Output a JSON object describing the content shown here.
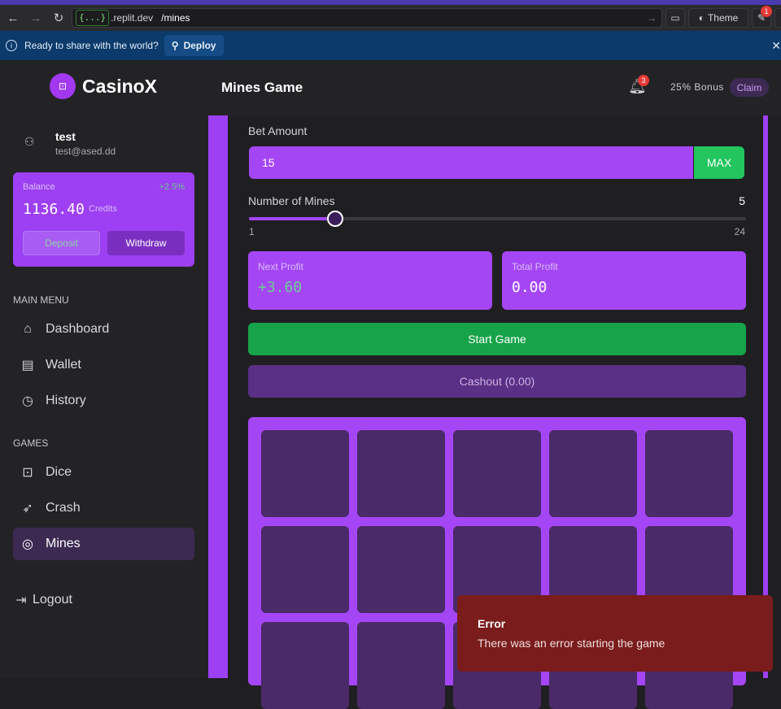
{
  "browser": {
    "domain_prefix": "{...}",
    "domain_rest": ".replit.dev",
    "path": "/mines",
    "theme_label": "Theme",
    "ext_badge": "1"
  },
  "sharebar": {
    "text": "Ready to share with the world?",
    "deploy_label": "Deploy"
  },
  "sidebar": {
    "brand": "CasinoX",
    "user_name": "test",
    "user_email": "test@ased.dd",
    "balance": {
      "label": "Balance",
      "change": "+2.5%",
      "value": "1136.40",
      "unit": "Credits",
      "deposit_label": "Deposit",
      "withdraw_label": "Withdraw"
    },
    "main_menu_label": "MAIN MENU",
    "main_menu": [
      {
        "label": "Dashboard",
        "icon": "home-icon"
      },
      {
        "label": "Wallet",
        "icon": "wallet-icon"
      },
      {
        "label": "History",
        "icon": "clock-icon"
      }
    ],
    "games_label": "GAMES",
    "games": [
      {
        "label": "Dice",
        "icon": "dice-icon"
      },
      {
        "label": "Crash",
        "icon": "rocket-icon"
      },
      {
        "label": "Mines",
        "icon": "target-icon"
      }
    ],
    "logout_label": "Logout"
  },
  "header": {
    "title": "Mines Game",
    "notifications": "3",
    "bonus_text": "25% Bonus",
    "claim_label": "Claim"
  },
  "game": {
    "bet_label": "Bet Amount",
    "bet_value": "15",
    "max_label": "MAX",
    "mines_label": "Number of Mines",
    "mines_value": "5",
    "mines_min": "1",
    "mines_max": "24",
    "mines_fraction": 0.174,
    "next_profit_label": "Next Profit",
    "next_profit_value": "+3.60",
    "total_profit_label": "Total Profit",
    "total_profit_value": "0.00",
    "start_label": "Start Game",
    "cashout_label": "Cashout (0.00)"
  },
  "toast": {
    "title": "Error",
    "message": "There was an error starting the game"
  },
  "colors": {
    "accent": "#9d3ff2",
    "success": "#16a34a",
    "error": "#7a1c1c"
  }
}
